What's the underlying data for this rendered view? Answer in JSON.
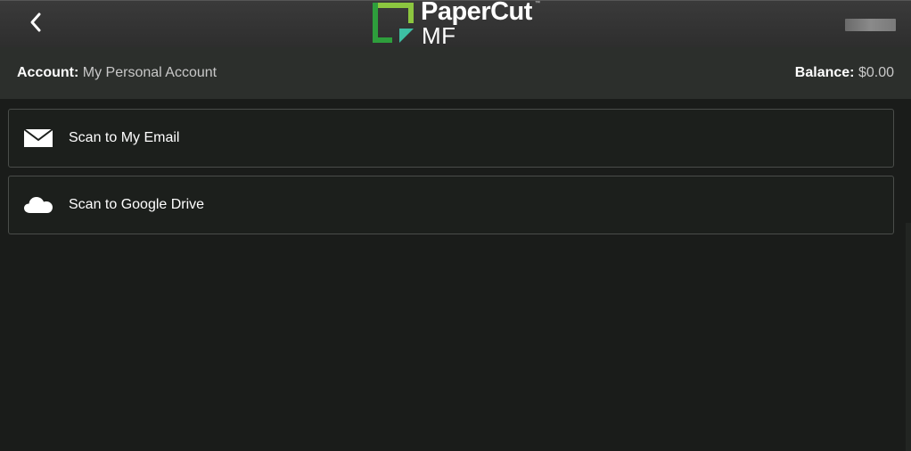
{
  "header": {
    "back_icon": "chevron-left-icon",
    "logo_text_line1": "PaperCut",
    "logo_trademark": "™",
    "logo_text_line2": "MF",
    "logo_colors": {
      "green_dark": "#2e9e3c",
      "green_light": "#8cc63f",
      "teal": "#3dbfa4"
    }
  },
  "account_bar": {
    "account_label": "Account:",
    "account_value": "My Personal Account",
    "balance_label": "Balance:",
    "balance_value": "$0.00"
  },
  "actions": [
    {
      "label": "Scan to My Email",
      "icon": "envelope-icon"
    },
    {
      "label": "Scan to Google Drive",
      "icon": "cloud-icon"
    }
  ],
  "colors": {
    "background": "#1a1c1a",
    "topbar": "#333333",
    "account_bar": "#2c2f2c",
    "item_border": "#4a4d4a"
  }
}
